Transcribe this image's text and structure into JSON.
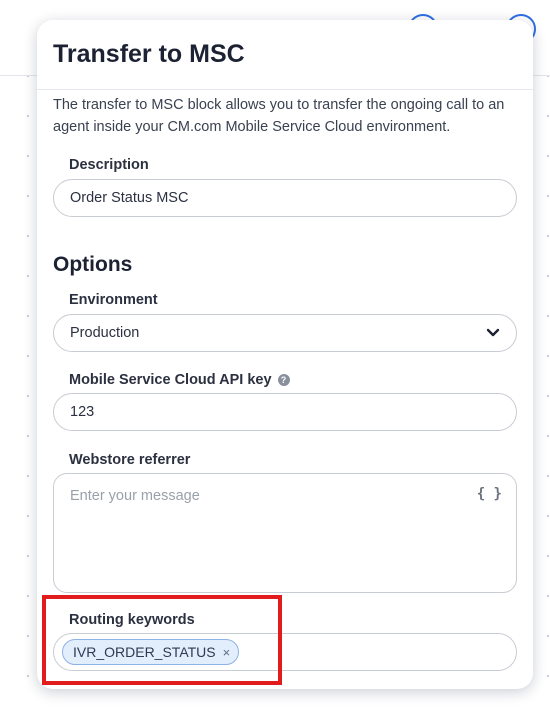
{
  "dialog": {
    "title": "Transfer to MSC",
    "description": "The transfer to MSC block allows you to transfer the ongoing call to an agent inside your CM.com Mobile Service Cloud environment."
  },
  "description_field": {
    "label": "Description",
    "value": "Order Status MSC"
  },
  "options": {
    "title": "Options",
    "environment": {
      "label": "Environment",
      "value": "Production"
    },
    "api_key": {
      "label": "Mobile Service Cloud API key",
      "value": "123"
    },
    "webstore_referrer": {
      "label": "Webstore referrer",
      "placeholder": "Enter your message",
      "variable_icon": "{ }"
    },
    "routing_keywords": {
      "label": "Routing keywords",
      "tags": [
        "IVR_ORDER_STATUS"
      ],
      "remove_glyph": "×"
    }
  },
  "colors": {
    "accent": "#2f6fe4",
    "highlight": "#e21c1c",
    "tag_bg": "#e3eefc",
    "tag_border": "#8fb2e6"
  },
  "icons": [
    "help-icon",
    "chevron-down-icon",
    "curly-braces-icon",
    "close-icon"
  ]
}
